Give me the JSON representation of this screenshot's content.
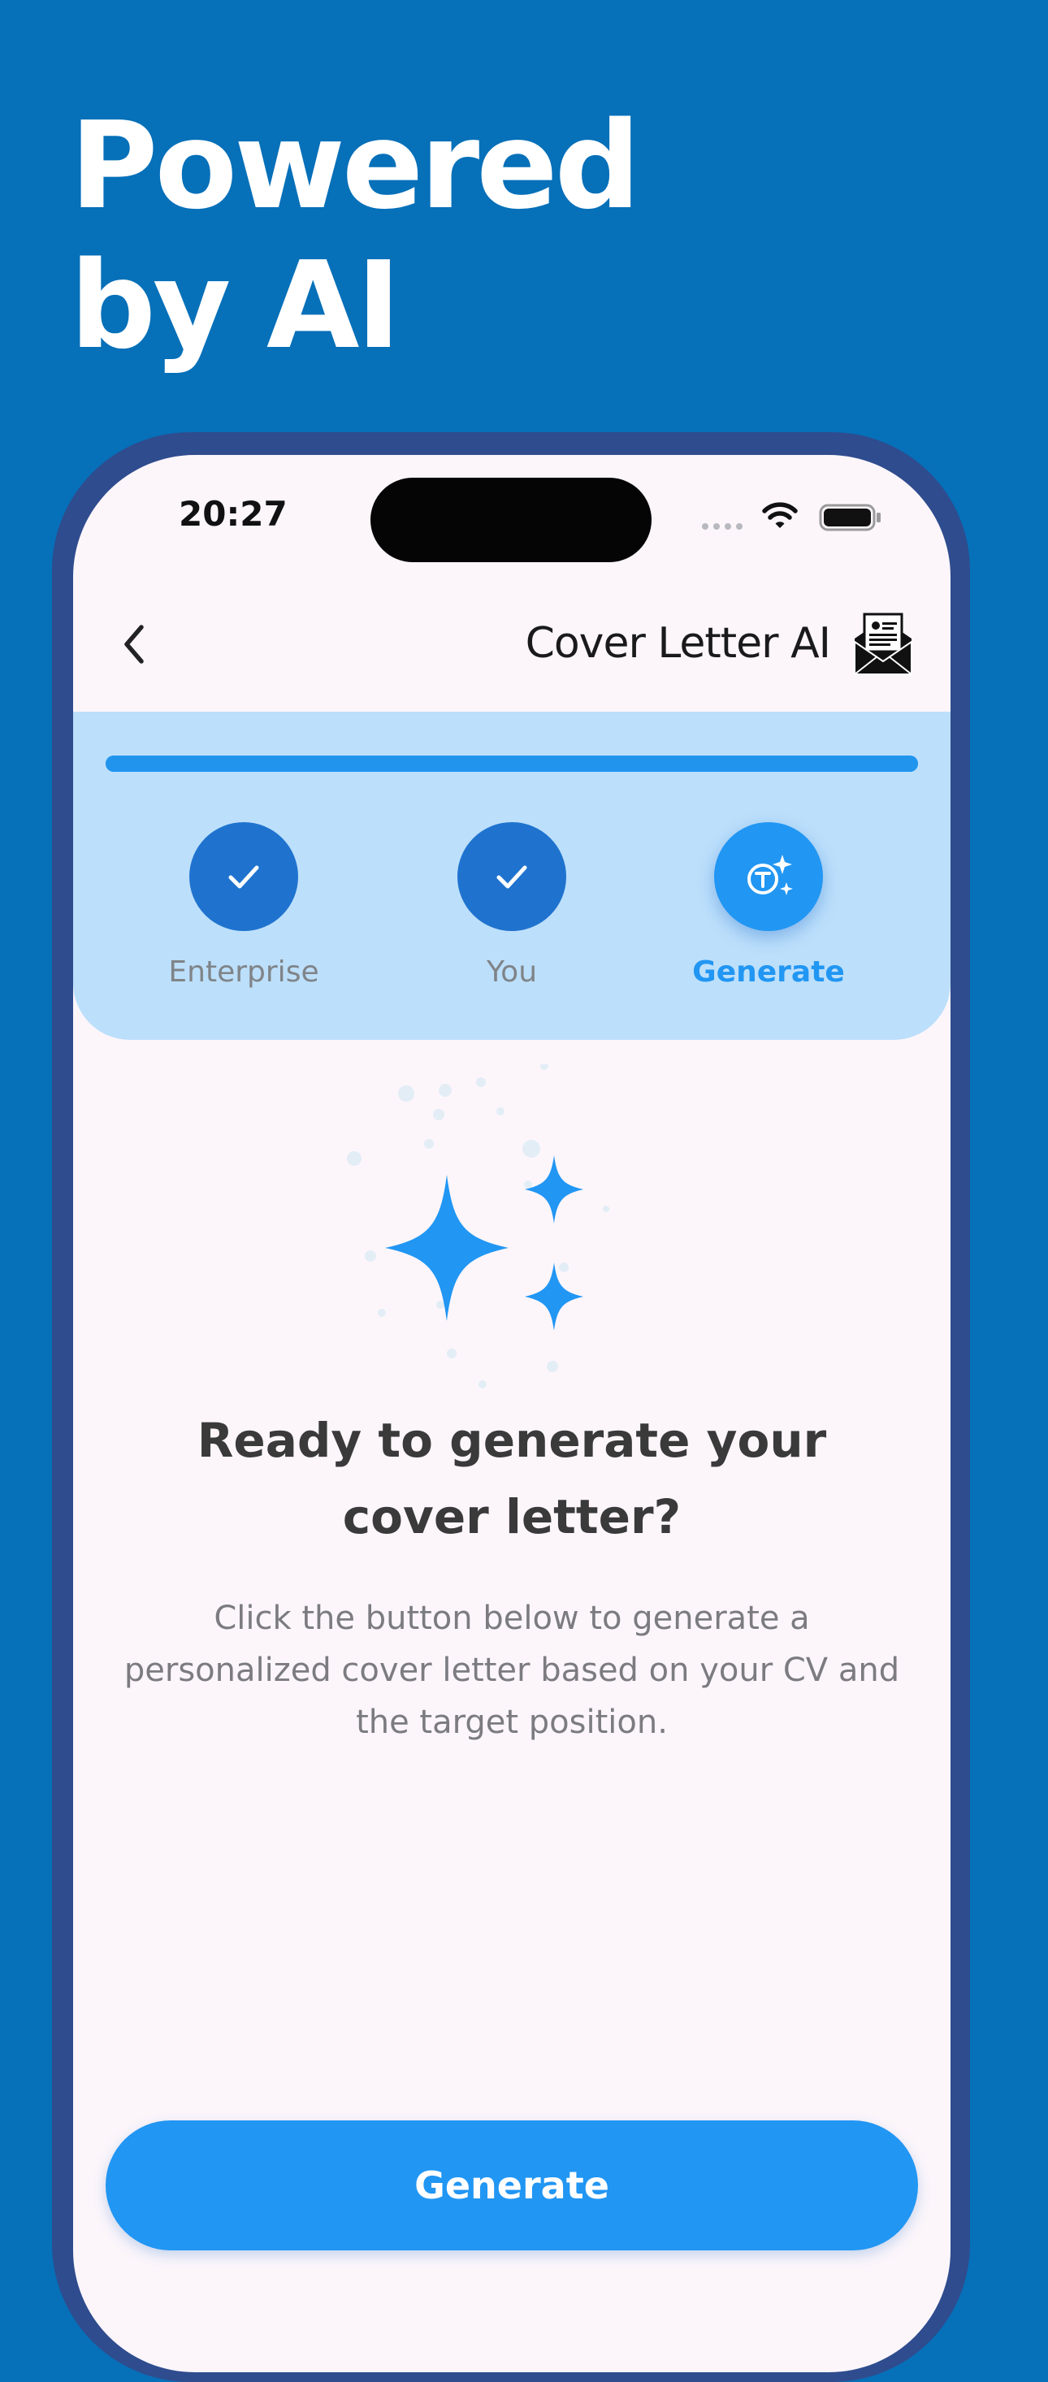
{
  "promo": {
    "headline_line1": "Powered",
    "headline_line2": "by AI"
  },
  "status_bar": {
    "time": "20:27",
    "icons": [
      "signal-dots-icon",
      "wifi-icon",
      "battery-icon"
    ]
  },
  "nav": {
    "back_icon": "chevron-left-icon",
    "title": "Cover Letter AI",
    "logo_icon": "envelope-letter-logo"
  },
  "stepper": {
    "progress": 1.0,
    "steps": [
      {
        "label": "Enterprise",
        "state": "done",
        "icon": "check-icon"
      },
      {
        "label": "You",
        "state": "done",
        "icon": "check-icon"
      },
      {
        "label": "Generate",
        "state": "active",
        "icon": "ai-text-sparkle-icon"
      }
    ]
  },
  "content": {
    "illustration_icon": "sparkles-icon",
    "title": "Ready to generate your cover letter?",
    "description": "Click the button below to generate a personalized cover letter based on your CV and the target position."
  },
  "actions": {
    "generate_label": "Generate"
  },
  "colors": {
    "background": "#0670b9",
    "phone_frame": "#2f4c8e",
    "screen": "#fcf6fb",
    "stepper_panel": "#bcdffb",
    "accent": "#2196f3",
    "step_done": "#1f73cf",
    "title_text": "#3a3a3a",
    "muted_text": "#7c7c80"
  }
}
